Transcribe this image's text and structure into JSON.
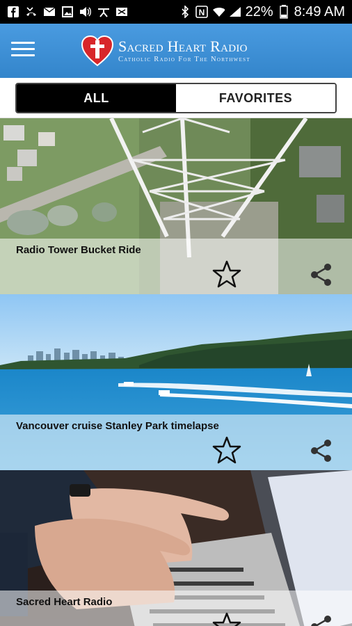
{
  "status_bar": {
    "battery_percent": "22%",
    "time": "8:49 AM",
    "left_icons": [
      "facebook-icon",
      "missed-call-icon",
      "mail-icon",
      "image-icon",
      "volume-icon",
      "accessibility-icon",
      "message-icon"
    ],
    "right_icons": [
      "bluetooth-icon",
      "nfc-icon",
      "wifi-icon",
      "signal-icon",
      "battery-icon"
    ]
  },
  "header": {
    "logo_title": "Sacred Heart Radio",
    "logo_subtitle": "Catholic Radio For The Northwest",
    "menu_icon": "hamburger-menu-icon",
    "colors": {
      "bar": "#3b8ed0",
      "heart": "#d8262a"
    }
  },
  "tabs": {
    "items": [
      {
        "label": "ALL",
        "active": true
      },
      {
        "label": "FAVORITES",
        "active": false
      }
    ]
  },
  "feed": {
    "items": [
      {
        "title": "Radio Tower Bucket Ride",
        "favorite_icon": "star-outline-icon",
        "share_icon": "share-icon"
      },
      {
        "title": "Vancouver cruise Stanley Park timelapse",
        "favorite_icon": "star-outline-icon",
        "share_icon": "share-icon"
      },
      {
        "title": "Sacred Heart Radio",
        "favorite_icon": "star-outline-icon",
        "share_icon": "share-icon"
      }
    ]
  }
}
